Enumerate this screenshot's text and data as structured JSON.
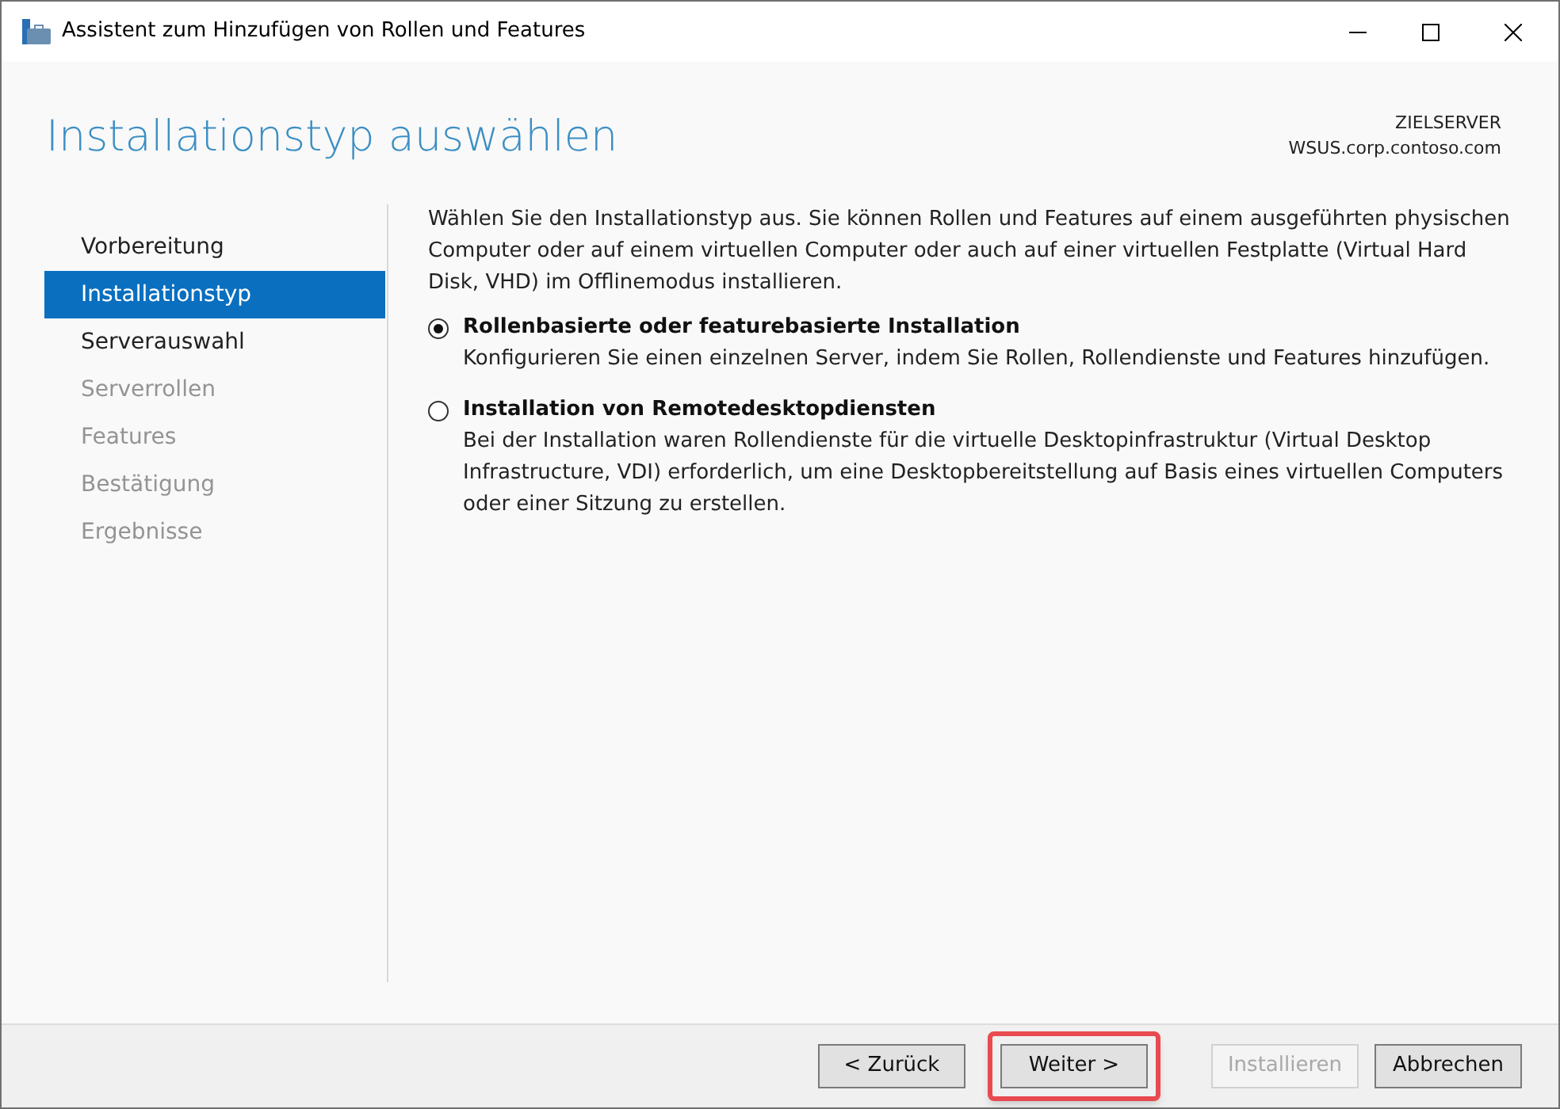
{
  "window": {
    "title": "Assistent zum Hinzufügen von Rollen und Features"
  },
  "header": {
    "title": "Installationstyp auswählen",
    "server_label": "ZIELSERVER",
    "server_name": "WSUS.corp.contoso.com"
  },
  "sidebar": {
    "items": [
      {
        "label": "Vorbereitung",
        "selected": false,
        "disabled": false
      },
      {
        "label": "Installationstyp",
        "selected": true,
        "disabled": false
      },
      {
        "label": "Serverauswahl",
        "selected": false,
        "disabled": false
      },
      {
        "label": "Serverrollen",
        "selected": false,
        "disabled": true
      },
      {
        "label": "Features",
        "selected": false,
        "disabled": true
      },
      {
        "label": "Bestätigung",
        "selected": false,
        "disabled": true
      },
      {
        "label": "Ergebnisse",
        "selected": false,
        "disabled": true
      }
    ]
  },
  "intro": "Wählen Sie den Installationstyp aus. Sie können Rollen und Features auf einem ausgeführten physischen Computer oder auf einem virtuellen Computer oder auch auf einer virtuellen Festplatte (Virtual Hard Disk, VHD) im Offlinemodus installieren.",
  "options": [
    {
      "label": "Rollenbasierte oder featurebasierte Installation",
      "description": "Konfigurieren Sie einen einzelnen Server, indem Sie Rollen, Rollendienste und Features hinzufügen.",
      "selected": true
    },
    {
      "label": "Installation von Remotedesktopdiensten",
      "description": "Bei der Installation waren Rollendienste für die virtuelle Desktopinfrastruktur (Virtual Desktop Infrastructure, VDI) erforderlich, um eine Desktopbereitstellung auf Basis eines virtuellen Computers oder einer Sitzung zu erstellen.",
      "selected": false
    }
  ],
  "buttons": [
    {
      "label": "< Zurück",
      "disabled": false,
      "highlighted": false
    },
    {
      "label": "Weiter >",
      "disabled": false,
      "highlighted": true
    },
    {
      "label": "Installieren",
      "disabled": true,
      "highlighted": false
    },
    {
      "label": "Abbrechen",
      "disabled": false,
      "highlighted": false
    }
  ]
}
